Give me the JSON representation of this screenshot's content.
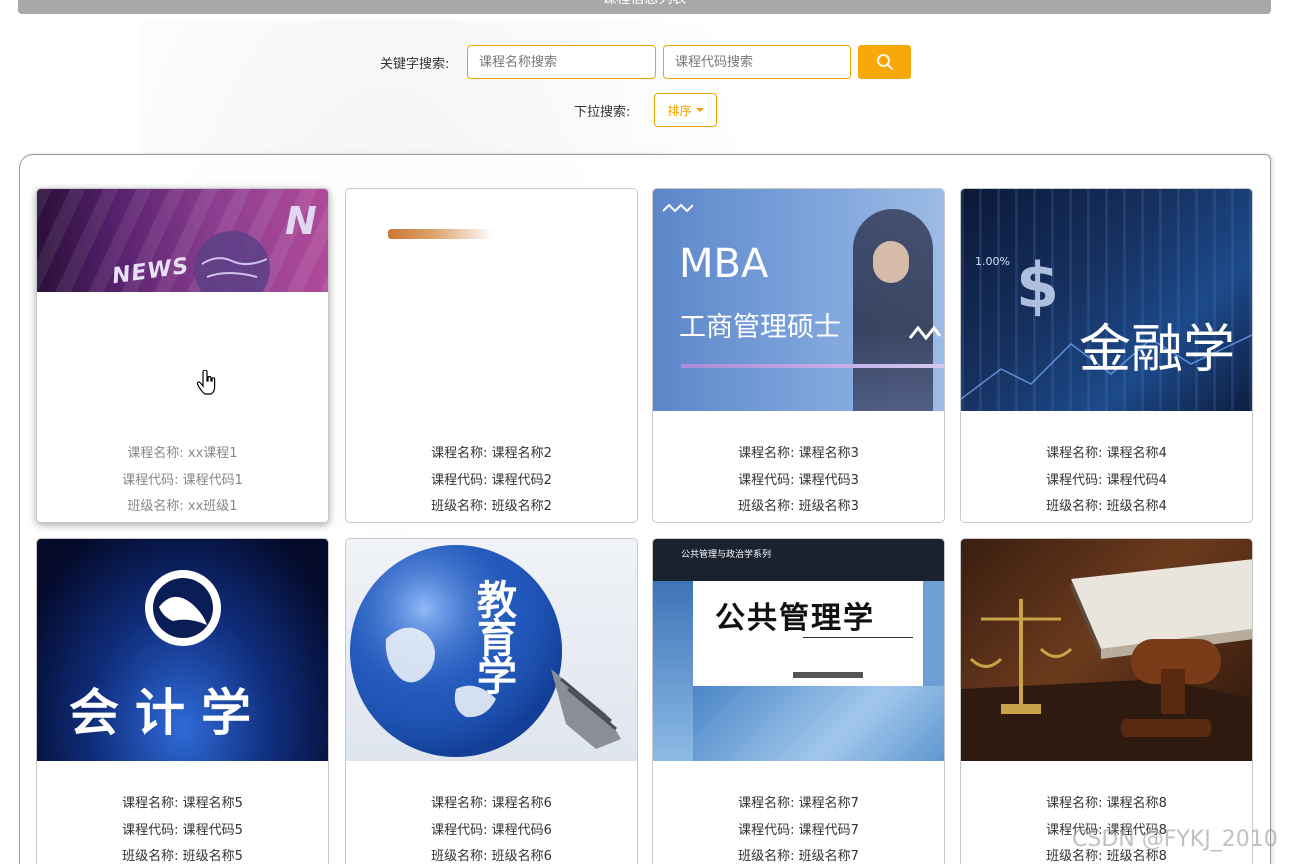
{
  "page": {
    "title": "课程信息列表"
  },
  "search": {
    "keyword_label": "关键字搜索:",
    "course_name_placeholder": "课程名称搜索",
    "course_code_placeholder": "课程代码搜索",
    "search_icon": "search-icon",
    "dropdown_label": "下拉搜索:",
    "sort_label": "排序"
  },
  "labels": {
    "course_name": "课程名称:",
    "course_code": "课程代码:",
    "class_name": "班级名称:"
  },
  "cards": [
    {
      "name": "xx课程1",
      "code": "课程代码1",
      "class": "xx班级1",
      "image_text": "NEWS"
    },
    {
      "name": "课程名称2",
      "code": "课程代码2",
      "class": "班级名称2",
      "image_text": ""
    },
    {
      "name": "课程名称3",
      "code": "课程代码3",
      "class": "班级名称3",
      "image_text": "MBA",
      "image_subtext": "工商管理硕士"
    },
    {
      "name": "课程名称4",
      "code": "课程代码4",
      "class": "班级名称4",
      "image_text": "金融学",
      "image_subtext": "1.00%"
    },
    {
      "name": "课程名称5",
      "code": "课程代码5",
      "class": "班级名称5",
      "image_text": "会计学"
    },
    {
      "name": "课程名称6",
      "code": "课程代码6",
      "class": "班级名称6",
      "image_text": "教育学"
    },
    {
      "name": "课程名称7",
      "code": "课程代码7",
      "class": "班级名称7",
      "image_text": "公共管理学",
      "image_subtext": "公共管理与政治学系列"
    },
    {
      "name": "课程名称8",
      "code": "课程代码8",
      "class": "班级名称8",
      "image_text": ""
    }
  ],
  "watermark": "CSDN @FYKJ_2010",
  "colors": {
    "accent": "#f8a90a",
    "title_bar": "#a8a8a8",
    "border": "#c8c8c8"
  }
}
